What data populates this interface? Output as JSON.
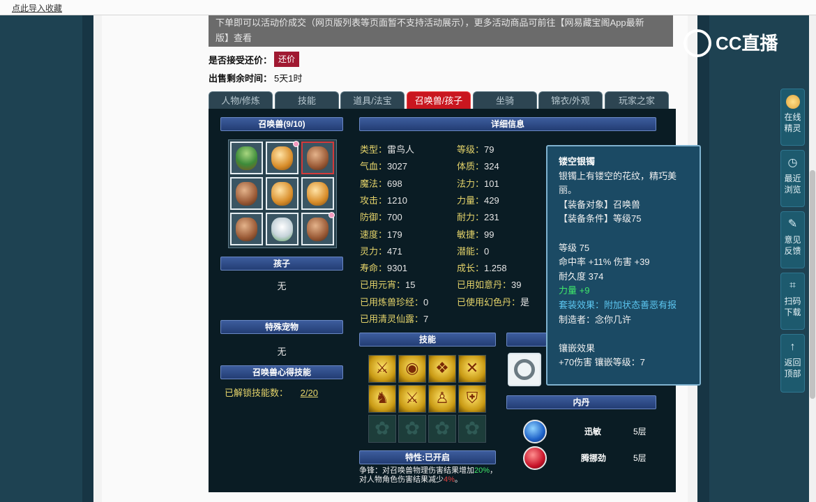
{
  "topbar": {
    "link": "点此导入收藏"
  },
  "notice": {
    "line1": "下单即可以活动价成交（网页版列表等页面暂不支持活动展示），更多活动商品可前往【网易藏宝阁App最新",
    "line2": "版】查看"
  },
  "bargain": {
    "label": "是否接受还价：",
    "button": "还价"
  },
  "remaining": {
    "label": "出售剩余时间：",
    "value": "5天1时"
  },
  "tabs": [
    "人物/修炼",
    "技能",
    "道具/法宝",
    "召唤兽/孩子",
    "坐骑",
    "锦衣/外观",
    "玩家之家"
  ],
  "active_tab": "召唤兽/孩子",
  "pets": {
    "header": "召唤兽(9/10)"
  },
  "child": {
    "header": "孩子",
    "value": "无"
  },
  "special_pet": {
    "header": "特殊宠物",
    "value": "无"
  },
  "mind_skill": {
    "header": "召唤兽心得技能",
    "label": "已解锁技能数：",
    "value": "2/20"
  },
  "detail": {
    "header": "详细信息"
  },
  "attrs_left": [
    {
      "k": "类型：",
      "v": "雷鸟人"
    },
    {
      "k": "气血：",
      "v": "3027"
    },
    {
      "k": "魔法：",
      "v": "698"
    },
    {
      "k": "攻击：",
      "v": "1210"
    },
    {
      "k": "防御：",
      "v": "700"
    },
    {
      "k": "速度：",
      "v": "179"
    },
    {
      "k": "灵力：",
      "v": "471"
    },
    {
      "k": "寿命：",
      "v": "9301"
    },
    {
      "k": "已用元宵：",
      "v": "15"
    },
    {
      "k": "已用炼兽珍经：",
      "v": "0"
    },
    {
      "k": "已用清灵仙露：",
      "v": "7"
    }
  ],
  "attrs_right": [
    {
      "k": "等级：",
      "v": "79"
    },
    {
      "k": "体质：",
      "v": "324"
    },
    {
      "k": "法力：",
      "v": "101"
    },
    {
      "k": "力量：",
      "v": "429"
    },
    {
      "k": "耐力：",
      "v": "231"
    },
    {
      "k": "敏捷：",
      "v": "99"
    },
    {
      "k": "潜能：",
      "v": "0"
    },
    {
      "k": "成长：",
      "v": "1.258"
    },
    {
      "k": "已用如意丹：",
      "v": "39"
    },
    {
      "k": "已使用幻色丹：",
      "v": "是"
    }
  ],
  "skills": {
    "header": "技能"
  },
  "traits": {
    "header": "特性:已开启",
    "line1a": "争锋：对召唤兽物理伤害结果增加",
    "line1b": "20%",
    "line1c": "，",
    "line2a": "对人物角色伤害结果减少",
    "line2b": "4%",
    "line2c": "。"
  },
  "neidan": {
    "header": "内丹",
    "items": [
      {
        "name": "迅敏",
        "level": "5层"
      },
      {
        "name": "腾挪劲",
        "level": "5层"
      }
    ]
  },
  "tooltip": {
    "title": "镂空银镯",
    "desc1": "银镯上有镂空的花纹，精巧美",
    "desc2": "丽。",
    "target": "【装备对象】召唤兽",
    "cond": "【装备条件】等级75",
    "level": "等级 75",
    "hit": "命中率 +11% 伤害 +39",
    "durability": "耐久度 374",
    "strength": "力量 +9",
    "suit": "套装效果：附加状态善恶有报",
    "maker": "制造者：念你几许",
    "inlay_title": "镶嵌效果",
    "inlay": "+70伤害 镶嵌等级：7"
  },
  "logo": {
    "text": "CC直播"
  },
  "sidebar": [
    {
      "label1": "在线",
      "label2": "精灵"
    },
    {
      "label1": "最近",
      "label2": "浏览"
    },
    {
      "label1": "意见",
      "label2": "反馈"
    },
    {
      "label1": "扫码",
      "label2": "下载"
    },
    {
      "label1": "返回",
      "label2": "顶部"
    }
  ]
}
